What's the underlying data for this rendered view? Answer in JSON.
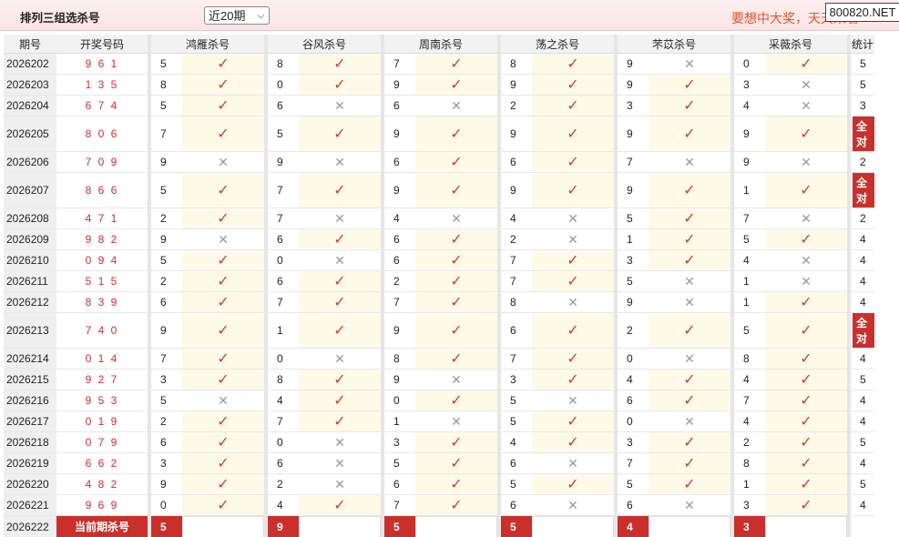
{
  "header": {
    "title": "排列三组选杀号",
    "period_select": "近20期",
    "slogan": "要想中大奖，天天来看",
    "watermark": "800820.NET"
  },
  "columns": {
    "issue": "期号",
    "draw": "开奖号码",
    "experts": [
      "鸿雁杀号",
      "谷风杀号",
      "周南杀号",
      "荡之杀号",
      "芣苡杀号",
      "采薇杀号"
    ],
    "stat": "统计"
  },
  "rows": [
    {
      "issue": "2026202",
      "draw": "9 6 1",
      "kills": [
        [
          5,
          1
        ],
        [
          8,
          1
        ],
        [
          7,
          1
        ],
        [
          8,
          1
        ],
        [
          9,
          0
        ],
        [
          0,
          1
        ]
      ],
      "stat": "5"
    },
    {
      "issue": "2026203",
      "draw": "1 3 5",
      "kills": [
        [
          8,
          1
        ],
        [
          0,
          1
        ],
        [
          9,
          1
        ],
        [
          9,
          1
        ],
        [
          9,
          1
        ],
        [
          3,
          0
        ]
      ],
      "stat": "5"
    },
    {
      "issue": "2026204",
      "draw": "6 7 4",
      "kills": [
        [
          5,
          1
        ],
        [
          6,
          0
        ],
        [
          6,
          0
        ],
        [
          2,
          1
        ],
        [
          3,
          1
        ],
        [
          4,
          0
        ]
      ],
      "stat": "3"
    },
    {
      "issue": "2026205",
      "draw": "8 0 6",
      "kills": [
        [
          7,
          1
        ],
        [
          5,
          1
        ],
        [
          9,
          1
        ],
        [
          9,
          1
        ],
        [
          9,
          1
        ],
        [
          9,
          1
        ]
      ],
      "stat": "全对"
    },
    {
      "issue": "2026206",
      "draw": "7 0 9",
      "kills": [
        [
          9,
          0
        ],
        [
          9,
          0
        ],
        [
          6,
          1
        ],
        [
          6,
          1
        ],
        [
          7,
          0
        ],
        [
          9,
          0
        ]
      ],
      "stat": "2"
    },
    {
      "issue": "2026207",
      "draw": "8 6 6",
      "kills": [
        [
          5,
          1
        ],
        [
          7,
          1
        ],
        [
          9,
          1
        ],
        [
          9,
          1
        ],
        [
          9,
          1
        ],
        [
          1,
          1
        ]
      ],
      "stat": "全对"
    },
    {
      "issue": "2026208",
      "draw": "4 7 1",
      "kills": [
        [
          2,
          1
        ],
        [
          7,
          0
        ],
        [
          4,
          0
        ],
        [
          4,
          0
        ],
        [
          5,
          1
        ],
        [
          7,
          0
        ]
      ],
      "stat": "2"
    },
    {
      "issue": "2026209",
      "draw": "9 8 2",
      "kills": [
        [
          9,
          0
        ],
        [
          6,
          1
        ],
        [
          6,
          1
        ],
        [
          2,
          0
        ],
        [
          1,
          1
        ],
        [
          5,
          1
        ]
      ],
      "stat": "4"
    },
    {
      "issue": "2026210",
      "draw": "0 9 4",
      "kills": [
        [
          5,
          1
        ],
        [
          0,
          0
        ],
        [
          6,
          1
        ],
        [
          7,
          1
        ],
        [
          3,
          1
        ],
        [
          4,
          0
        ]
      ],
      "stat": "4"
    },
    {
      "issue": "2026211",
      "draw": "5 1 5",
      "kills": [
        [
          2,
          1
        ],
        [
          6,
          1
        ],
        [
          2,
          1
        ],
        [
          7,
          1
        ],
        [
          5,
          0
        ],
        [
          1,
          0
        ]
      ],
      "stat": "4"
    },
    {
      "issue": "2026212",
      "draw": "8 3 9",
      "kills": [
        [
          6,
          1
        ],
        [
          7,
          1
        ],
        [
          7,
          1
        ],
        [
          8,
          0
        ],
        [
          9,
          0
        ],
        [
          1,
          1
        ]
      ],
      "stat": "4"
    },
    {
      "issue": "2026213",
      "draw": "7 4 0",
      "kills": [
        [
          9,
          1
        ],
        [
          1,
          1
        ],
        [
          9,
          1
        ],
        [
          6,
          1
        ],
        [
          2,
          1
        ],
        [
          5,
          1
        ]
      ],
      "stat": "全对"
    },
    {
      "issue": "2026214",
      "draw": "0 1 4",
      "kills": [
        [
          7,
          1
        ],
        [
          0,
          0
        ],
        [
          8,
          1
        ],
        [
          7,
          1
        ],
        [
          0,
          0
        ],
        [
          8,
          1
        ]
      ],
      "stat": "4"
    },
    {
      "issue": "2026215",
      "draw": "9 2 7",
      "kills": [
        [
          3,
          1
        ],
        [
          8,
          1
        ],
        [
          9,
          0
        ],
        [
          3,
          1
        ],
        [
          4,
          1
        ],
        [
          4,
          1
        ]
      ],
      "stat": "5"
    },
    {
      "issue": "2026216",
      "draw": "9 5 3",
      "kills": [
        [
          5,
          0
        ],
        [
          4,
          1
        ],
        [
          0,
          1
        ],
        [
          5,
          0
        ],
        [
          6,
          1
        ],
        [
          7,
          1
        ]
      ],
      "stat": "4"
    },
    {
      "issue": "2026217",
      "draw": "0 1 9",
      "kills": [
        [
          2,
          1
        ],
        [
          7,
          1
        ],
        [
          1,
          0
        ],
        [
          5,
          1
        ],
        [
          0,
          0
        ],
        [
          4,
          1
        ]
      ],
      "stat": "4"
    },
    {
      "issue": "2026218",
      "draw": "0 7 9",
      "kills": [
        [
          6,
          1
        ],
        [
          0,
          0
        ],
        [
          3,
          1
        ],
        [
          4,
          1
        ],
        [
          3,
          1
        ],
        [
          2,
          1
        ]
      ],
      "stat": "5"
    },
    {
      "issue": "2026219",
      "draw": "6 6 2",
      "kills": [
        [
          3,
          1
        ],
        [
          6,
          0
        ],
        [
          5,
          1
        ],
        [
          6,
          0
        ],
        [
          7,
          1
        ],
        [
          8,
          1
        ]
      ],
      "stat": "4"
    },
    {
      "issue": "2026220",
      "draw": "4 8 2",
      "kills": [
        [
          9,
          1
        ],
        [
          2,
          0
        ],
        [
          6,
          1
        ],
        [
          5,
          1
        ],
        [
          5,
          1
        ],
        [
          1,
          1
        ]
      ],
      "stat": "5"
    },
    {
      "issue": "2026221",
      "draw": "9 6 9",
      "kills": [
        [
          0,
          1
        ],
        [
          4,
          1
        ],
        [
          7,
          1
        ],
        [
          6,
          0
        ],
        [
          6,
          0
        ],
        [
          3,
          1
        ]
      ],
      "stat": "4"
    }
  ],
  "footer": {
    "issue": "2026222",
    "label": "当前期杀号",
    "kills": [
      "5",
      "9",
      "5",
      "5",
      "4",
      "3"
    ]
  }
}
